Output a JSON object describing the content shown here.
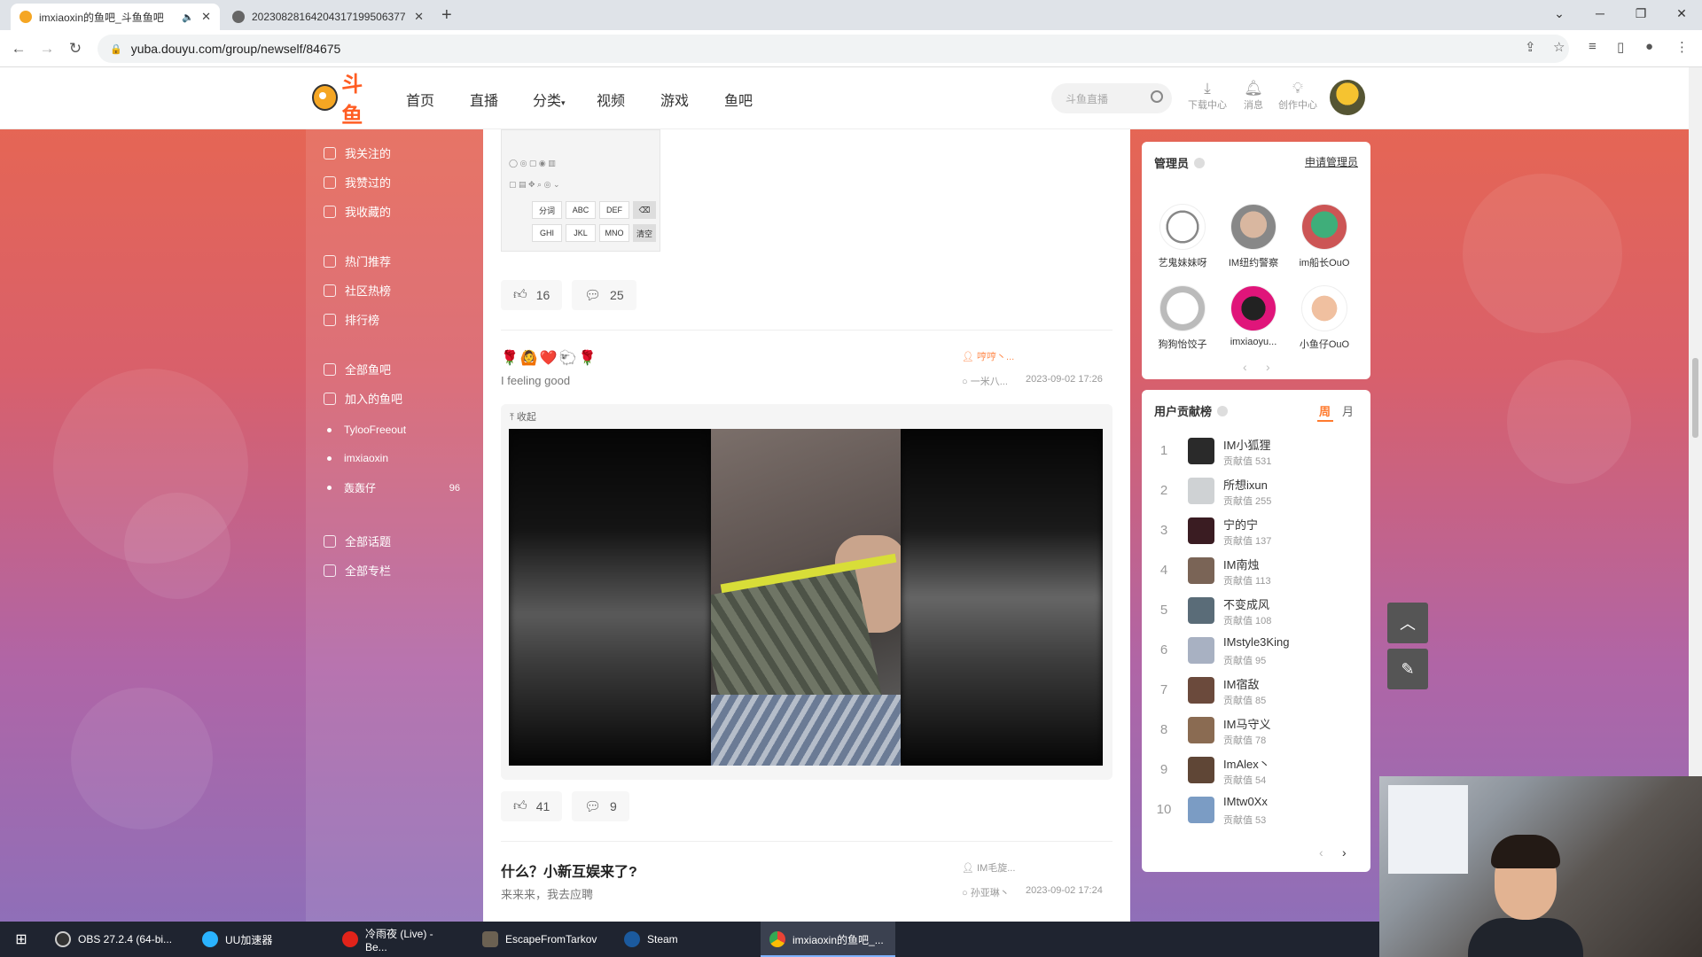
{
  "browser": {
    "tabs": [
      {
        "title": "imxiaoxin的鱼吧_斗鱼鱼吧"
      },
      {
        "title": "20230828164204317199506377"
      }
    ],
    "url": "yuba.douyu.com/group/newself/84675"
  },
  "header": {
    "logo_text": "斗鱼",
    "nav": [
      "首页",
      "直播",
      "分类",
      "视频",
      "游戏",
      "鱼吧"
    ],
    "search_placeholder": "斗鱼直播",
    "icons": [
      {
        "label": "下载中心",
        "icon": "download-icon"
      },
      {
        "label": "消息",
        "icon": "bell-icon"
      },
      {
        "label": "创作中心",
        "icon": "bulb-icon"
      }
    ]
  },
  "sidebar": {
    "top_items": [
      "我关注的",
      "我赞过的",
      "我收藏的"
    ],
    "mid_items": [
      "热门推荐",
      "社区热榜",
      "排行榜"
    ],
    "group_items": [
      "全部鱼吧",
      "加入的鱼吧"
    ],
    "joined": [
      {
        "name": "TylooFreeout",
        "count": ""
      },
      {
        "name": "imxiaoxin",
        "count": ""
      },
      {
        "name": "轰轰仔",
        "count": "96"
      }
    ],
    "bottom_items": [
      "全部话题",
      "全部专栏"
    ]
  },
  "feed": {
    "thumb_keys": [
      "分词",
      "ABC",
      "DEF",
      "⌫",
      "GHI",
      "JKL",
      "MNO",
      "清空"
    ],
    "post1_actions": {
      "likes": "16",
      "comments": "25"
    },
    "post2": {
      "emoji": "🌹🙆❤️🐑🌹",
      "subtitle": "I feeling good",
      "author": "哼哼丶...",
      "commenter": "一米八...",
      "time": "2023-09-02 17:26",
      "collapse": "收起",
      "likes": "41",
      "comments": "9"
    },
    "post3": {
      "title": "什么？小新互娱来了?",
      "subtitle": "来来来，我去应聘",
      "author": "IM毛旋...",
      "commenter": "孙亚琳丶",
      "time": "2023-09-02 17:24"
    }
  },
  "admins": {
    "title": "管理员",
    "apply": "申请管理员",
    "list": [
      "艺鬼妹妹呀",
      "IM纽约警察",
      "im船长OuO",
      "狗狗怡饺子",
      "imxiaoyu...",
      "小鱼仔OuO"
    ]
  },
  "ranking": {
    "title": "用户贡献榜",
    "tabs": [
      "周",
      "月"
    ],
    "rows": [
      {
        "rank": "1",
        "name": "IM小狐狸",
        "score": "贡献值 531",
        "color": "#2a2a2a"
      },
      {
        "rank": "2",
        "name": "所想ixun",
        "score": "贡献值 255",
        "color": "#cfd2d4"
      },
      {
        "rank": "3",
        "name": "宁的宁",
        "score": "贡献值 137",
        "color": "#3a1c22"
      },
      {
        "rank": "4",
        "name": "IM南烛",
        "score": "贡献值 113",
        "color": "#7a6456"
      },
      {
        "rank": "5",
        "name": "不变成风",
        "score": "贡献值 108",
        "color": "#5a6c78"
      },
      {
        "rank": "6",
        "name": "IMstyle3King",
        "score": "贡献值 95",
        "color": "#a8b1c2"
      },
      {
        "rank": "7",
        "name": "IM宿敌",
        "score": "贡献值 85",
        "color": "#6b4a3c"
      },
      {
        "rank": "8",
        "name": "IM马守义",
        "score": "贡献值 78",
        "color": "#8a6b52"
      },
      {
        "rank": "9",
        "name": "ImAlex丶",
        "score": "贡献值 54",
        "color": "#5f4636"
      },
      {
        "rank": "10",
        "name": "IMtw0Xx",
        "score": "贡献值 53",
        "color": "#7b9cc4"
      }
    ]
  },
  "taskbar": {
    "items": [
      "OBS 27.2.4 (64-bi...",
      "UU加速器",
      "冷雨夜 (Live) - Be...",
      "EscapeFromTarkov",
      "Steam",
      "imxiaoxin的鱼吧_..."
    ]
  }
}
